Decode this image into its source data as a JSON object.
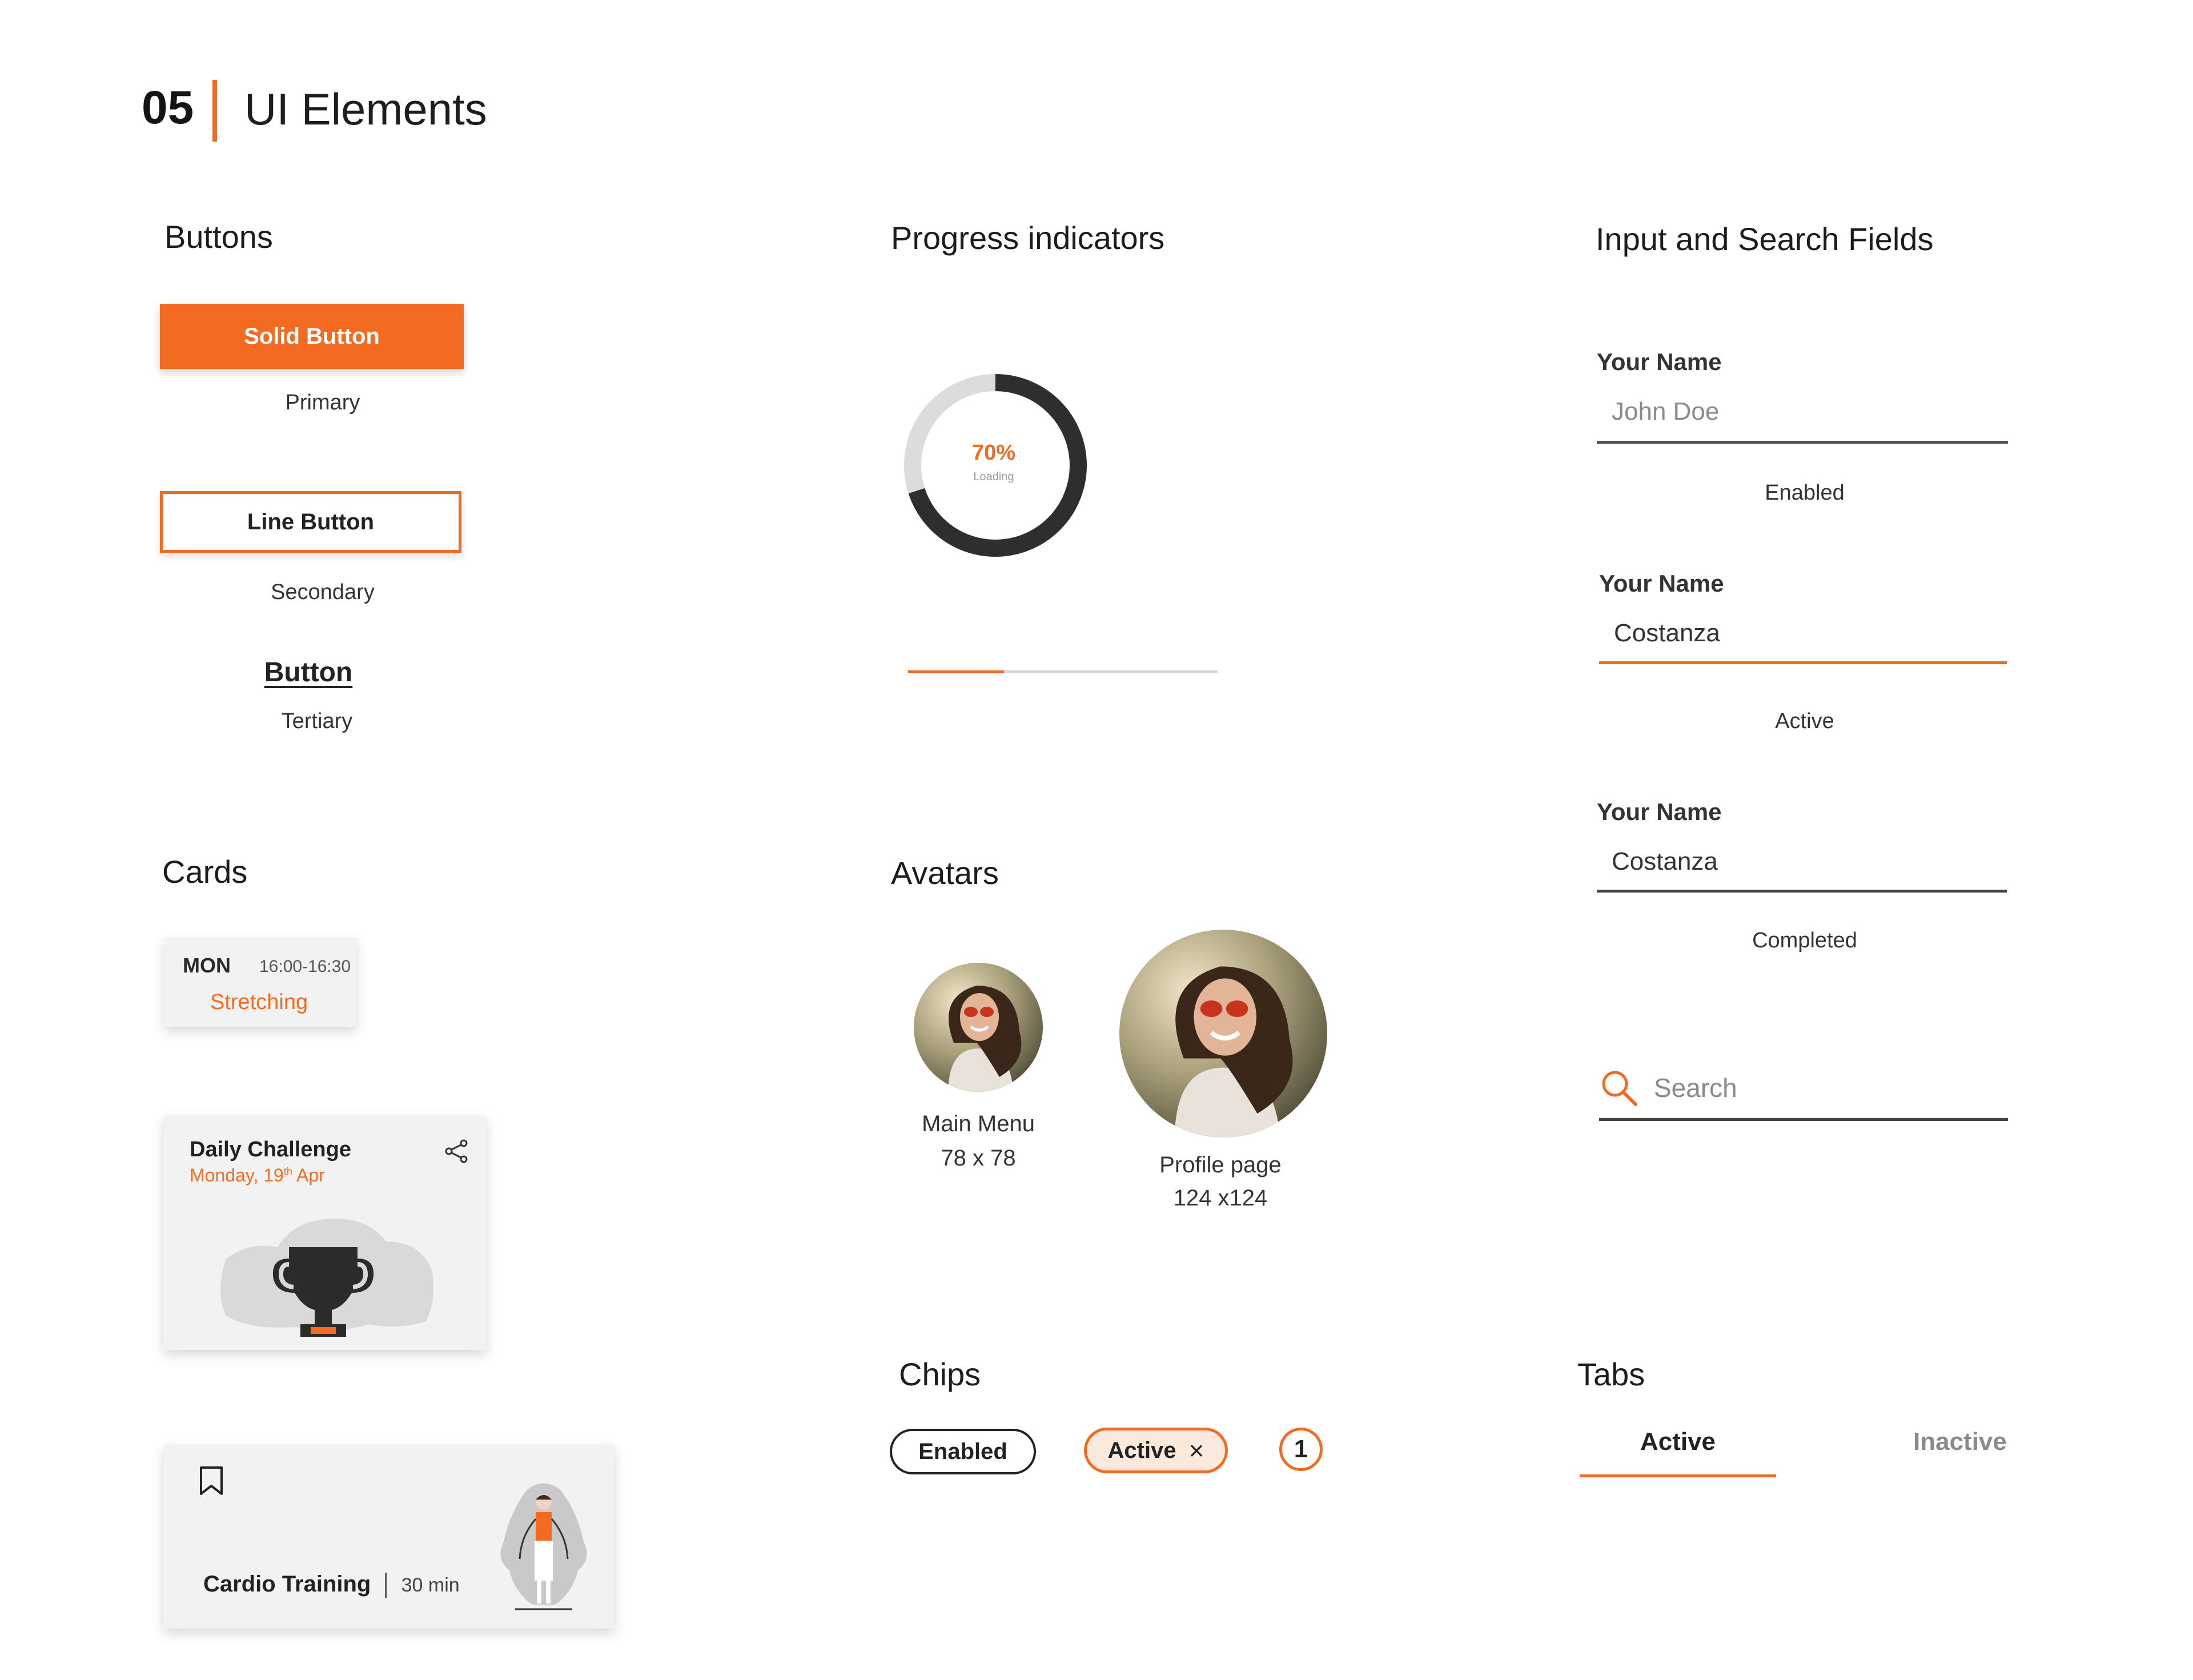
{
  "header": {
    "number": "05",
    "title": "UI Elements"
  },
  "colors": {
    "accent": "#f26b21",
    "text": "#2b2b2b",
    "muted": "#8a8a8a",
    "card_bg": "#f2f2f2"
  },
  "buttons": {
    "title": "Buttons",
    "solid_label": "Solid Button",
    "solid_caption": "Primary",
    "line_label": "Line Button",
    "line_caption": "Secondary",
    "tertiary_label": "Button",
    "tertiary_caption": "Tertiary"
  },
  "progress": {
    "title": "Progress indicators",
    "ring_percent_text": "70%",
    "ring_percent_value": 0.7,
    "ring_sub": "Loading",
    "bar_fraction": 0.31
  },
  "inputs": {
    "title": "Input and Search Fields",
    "fields": [
      {
        "label": "Your Name",
        "placeholder": "John Doe",
        "value": "",
        "state": "Enabled"
      },
      {
        "label": "Your Name",
        "value": "Costanza",
        "state": "Active"
      },
      {
        "label": "Your Name",
        "value": "Costanza",
        "state": "Completed"
      }
    ],
    "search_placeholder": "Search",
    "search_icon": "search-icon"
  },
  "cards": {
    "title": "Cards",
    "schedule": {
      "day": "MON",
      "time": "16:00-16:30",
      "activity": "Stretching"
    },
    "challenge": {
      "title": "Daily Challenge",
      "date_main": "Monday, 19",
      "date_sup": "th",
      "date_end": " Apr",
      "icon": "share-icon",
      "illustration": "trophy-icon"
    },
    "workout": {
      "title": "Cardio Training",
      "duration": "30 min",
      "icon": "bookmark-icon",
      "illustration": "jump-rope-person"
    }
  },
  "avatars": {
    "title": "Avatars",
    "items": [
      {
        "name": "Main Menu",
        "size": "78 x 78"
      },
      {
        "name": "Profile page",
        "size": "124 x124"
      }
    ]
  },
  "chips": {
    "title": "Chips",
    "enabled_label": "Enabled",
    "active_label": "Active",
    "close_glyph": "×",
    "count": "1"
  },
  "tabs": {
    "title": "Tabs",
    "items": [
      {
        "label": "Active",
        "active": true
      },
      {
        "label": "Inactive",
        "active": false
      }
    ]
  }
}
